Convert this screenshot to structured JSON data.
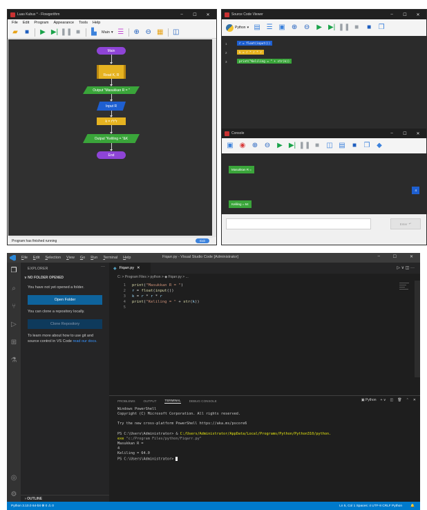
{
  "flowgorithm": {
    "title": "Luas Kubus * - Flowgorithm",
    "controls": [
      "–",
      "☐",
      "✕"
    ],
    "menu": [
      "File",
      "Edit",
      "Program",
      "Appearance",
      "Tools",
      "Help"
    ],
    "function_select": "Main",
    "flowchart": {
      "start": "Main",
      "loop": "Read K, R",
      "output1": "Output \"Masukkan R = \"",
      "input": "Input R",
      "assign": "k = r*r*r",
      "output2": "Output \"Keliling = \"&K",
      "end": "End"
    },
    "status": "Program has finished running",
    "exit_button": "Exit"
  },
  "source_viewer": {
    "title": "Source Code Viewer",
    "language": "Python",
    "lines": [
      {
        "num": "1",
        "code": "r = float(input())",
        "color": "#1e5fd0"
      },
      {
        "num": "2",
        "code": "k = r * r * r",
        "color": "#e6b321"
      },
      {
        "num": "3",
        "code": "print(\"Keliling = \" + str(k))",
        "color": "#3aa53a"
      }
    ]
  },
  "console": {
    "title": "Console",
    "messages": {
      "prompt": "Masukkan R =",
      "input_value": "4",
      "result": "Keliling = 64"
    },
    "enter_button": "Enter"
  },
  "vscode": {
    "title": "Fiqarr.py - Visual Studio Code [Administrator]",
    "menu": [
      {
        "pre": "",
        "u": "F",
        "post": "ile"
      },
      {
        "pre": "",
        "u": "E",
        "post": "dit"
      },
      {
        "pre": "",
        "u": "S",
        "post": "election"
      },
      {
        "pre": "",
        "u": "V",
        "post": "iew"
      },
      {
        "pre": "",
        "u": "G",
        "post": "o"
      },
      {
        "pre": "",
        "u": "R",
        "post": "un"
      },
      {
        "pre": "",
        "u": "T",
        "post": "erminal"
      },
      {
        "pre": "",
        "u": "H",
        "post": "elp"
      }
    ],
    "explorer": {
      "heading": "EXPLORER",
      "section": "NO FOLDER OPENED",
      "no_folder_text": "You have not yet opened a folder.",
      "open_folder": "Open Folder",
      "clone_text": "You can clone a repository locally.",
      "clone_button": "Clone Repository",
      "learn_text": "To learn more about how to use git and source control in VS Code",
      "learn_link": "read our docs.",
      "outline": "OUTLINE"
    },
    "tab": "Fiqarr.py",
    "breadcrumb": "C: > Program Files > python > ◆ Fiqarr.py > ...",
    "code": [
      {
        "n": "1",
        "parts": [
          [
            "kw",
            "print"
          ],
          [
            "op",
            "("
          ],
          [
            "st",
            "\"Masukkan R = \""
          ],
          [
            "op",
            ")"
          ]
        ]
      },
      {
        "n": "2",
        "parts": [
          [
            "vr",
            "r"
          ],
          [
            "op",
            " = "
          ],
          [
            "kw",
            "float"
          ],
          [
            "op",
            "("
          ],
          [
            "kw",
            "input"
          ],
          [
            "op",
            "())"
          ]
        ]
      },
      {
        "n": "3",
        "parts": [
          [
            "vr",
            "k"
          ],
          [
            "op",
            " = "
          ],
          [
            "vr",
            "r"
          ],
          [
            "op",
            " * "
          ],
          [
            "vr",
            "r"
          ],
          [
            "op",
            " * "
          ],
          [
            "vr",
            "r"
          ]
        ]
      },
      {
        "n": "4",
        "parts": [
          [
            "kw",
            "print"
          ],
          [
            "op",
            "("
          ],
          [
            "st",
            "\"Keliling = \""
          ],
          [
            "op",
            " + "
          ],
          [
            "kw",
            "str"
          ],
          [
            "op",
            "("
          ],
          [
            "vr",
            "k"
          ],
          [
            "op",
            "))"
          ]
        ]
      },
      {
        "n": "5",
        "parts": []
      }
    ],
    "panel_tabs": [
      "PROBLEMS",
      "OUTPUT",
      "TERMINAL",
      "DEBUG CONSOLE"
    ],
    "active_panel_tab": "TERMINAL",
    "terminal_shell": "Python",
    "terminal": {
      "l1": "Windows PowerShell",
      "l2": "Copyright (C) Microsoft Corporation. All rights reserved.",
      "l3": "Try the new cross-platform PowerShell https://aka.ms/pscore6",
      "l4a": "PS C:\\Users\\Administrator> & ",
      "l4b": "C:/Users/Administrator/AppData/Local/Programs/Python/Python310/python.",
      "l5a": "exe ",
      "l5b": "\"c:/Program Files/python/Fiqarr.py\"",
      "l6": "Masukkan R =",
      "l7": "4",
      "l8": "Keliling = 64.0",
      "l9": "PS C:\\Users\\Administrator> "
    },
    "status": {
      "left": "Python 3.10.0 64-bit   ⊗ 0 ⚠ 0",
      "right": "Ln 5, Col 1   Spaces: 4   UTF-8   CRLF   Python"
    }
  }
}
